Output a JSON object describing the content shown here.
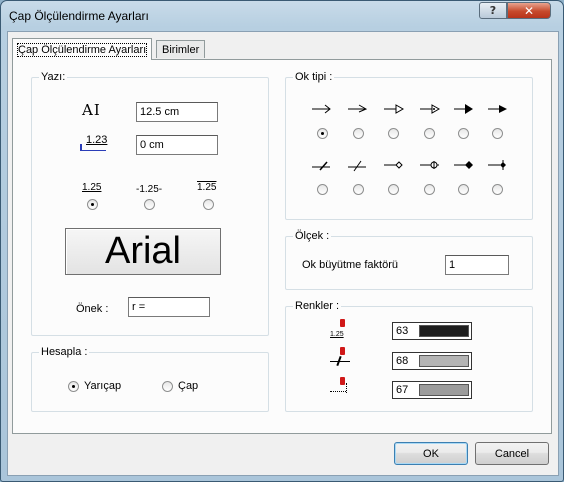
{
  "window": {
    "title": "Çap Ölçülendirme Ayarları",
    "help_label": "?",
    "close_label": "✕"
  },
  "tabs": [
    {
      "label": "Çap Ölçülendirme Ayarları"
    },
    {
      "label": "Birimler"
    }
  ],
  "yazi": {
    "group_label": "Yazı:",
    "text_height_icon_label": "AI",
    "text_height_value": "12.5 cm",
    "offset_icon_label": "1.23",
    "offset_value": "0 cm",
    "position_options": [
      {
        "label": "1.25",
        "checked": true
      },
      {
        "label": "-1.25-",
        "checked": false
      },
      {
        "label": "1.25",
        "checked": false
      }
    ],
    "font_button_label": "Arial",
    "prefix_label": "Önek :",
    "prefix_value": "r ="
  },
  "hesapla": {
    "group_label": "Hesapla :",
    "options": [
      {
        "label": "Yarıçap",
        "checked": true
      },
      {
        "label": "Çap",
        "checked": false
      }
    ]
  },
  "ok_tipi": {
    "group_label": "Ok tipi :",
    "row1": [
      {
        "icon": "line-arrow-icon",
        "checked": true
      },
      {
        "icon": "half-arrow-icon",
        "checked": false
      },
      {
        "icon": "open-triangle-arrow-icon",
        "checked": false
      },
      {
        "icon": "open-dot-triangle-arrow-icon",
        "checked": false
      },
      {
        "icon": "filled-triangle-arrow-icon",
        "checked": false
      },
      {
        "icon": "filled-wide-arrow-icon",
        "checked": false
      }
    ],
    "row2": [
      {
        "icon": "tick-slash-icon",
        "checked": false
      },
      {
        "icon": "slash-tick-icon",
        "checked": false
      },
      {
        "icon": "open-diamond-icon",
        "checked": false
      },
      {
        "icon": "crossed-circle-icon",
        "checked": false
      },
      {
        "icon": "filled-diamond-icon",
        "checked": false
      },
      {
        "icon": "filled-diamond-plus-icon",
        "checked": false
      }
    ]
  },
  "olcek": {
    "group_label": "Ölçek :",
    "factor_label": "Ok büyütme faktörü",
    "factor_value": "1"
  },
  "renkler": {
    "group_label": "Renkler :",
    "rows": [
      {
        "icon": "text-color-icon",
        "icon_text": "1.25",
        "value": "63",
        "swatch": "#1e1e1e"
      },
      {
        "icon": "line-color-icon",
        "value": "68",
        "swatch": "#b4b4b4"
      },
      {
        "icon": "extension-color-icon",
        "value": "67",
        "swatch": "#9c9c9c"
      }
    ]
  },
  "buttons": {
    "ok_label": "OK",
    "cancel_label": "Cancel"
  },
  "colors": {
    "accent_red": "#d01818"
  }
}
